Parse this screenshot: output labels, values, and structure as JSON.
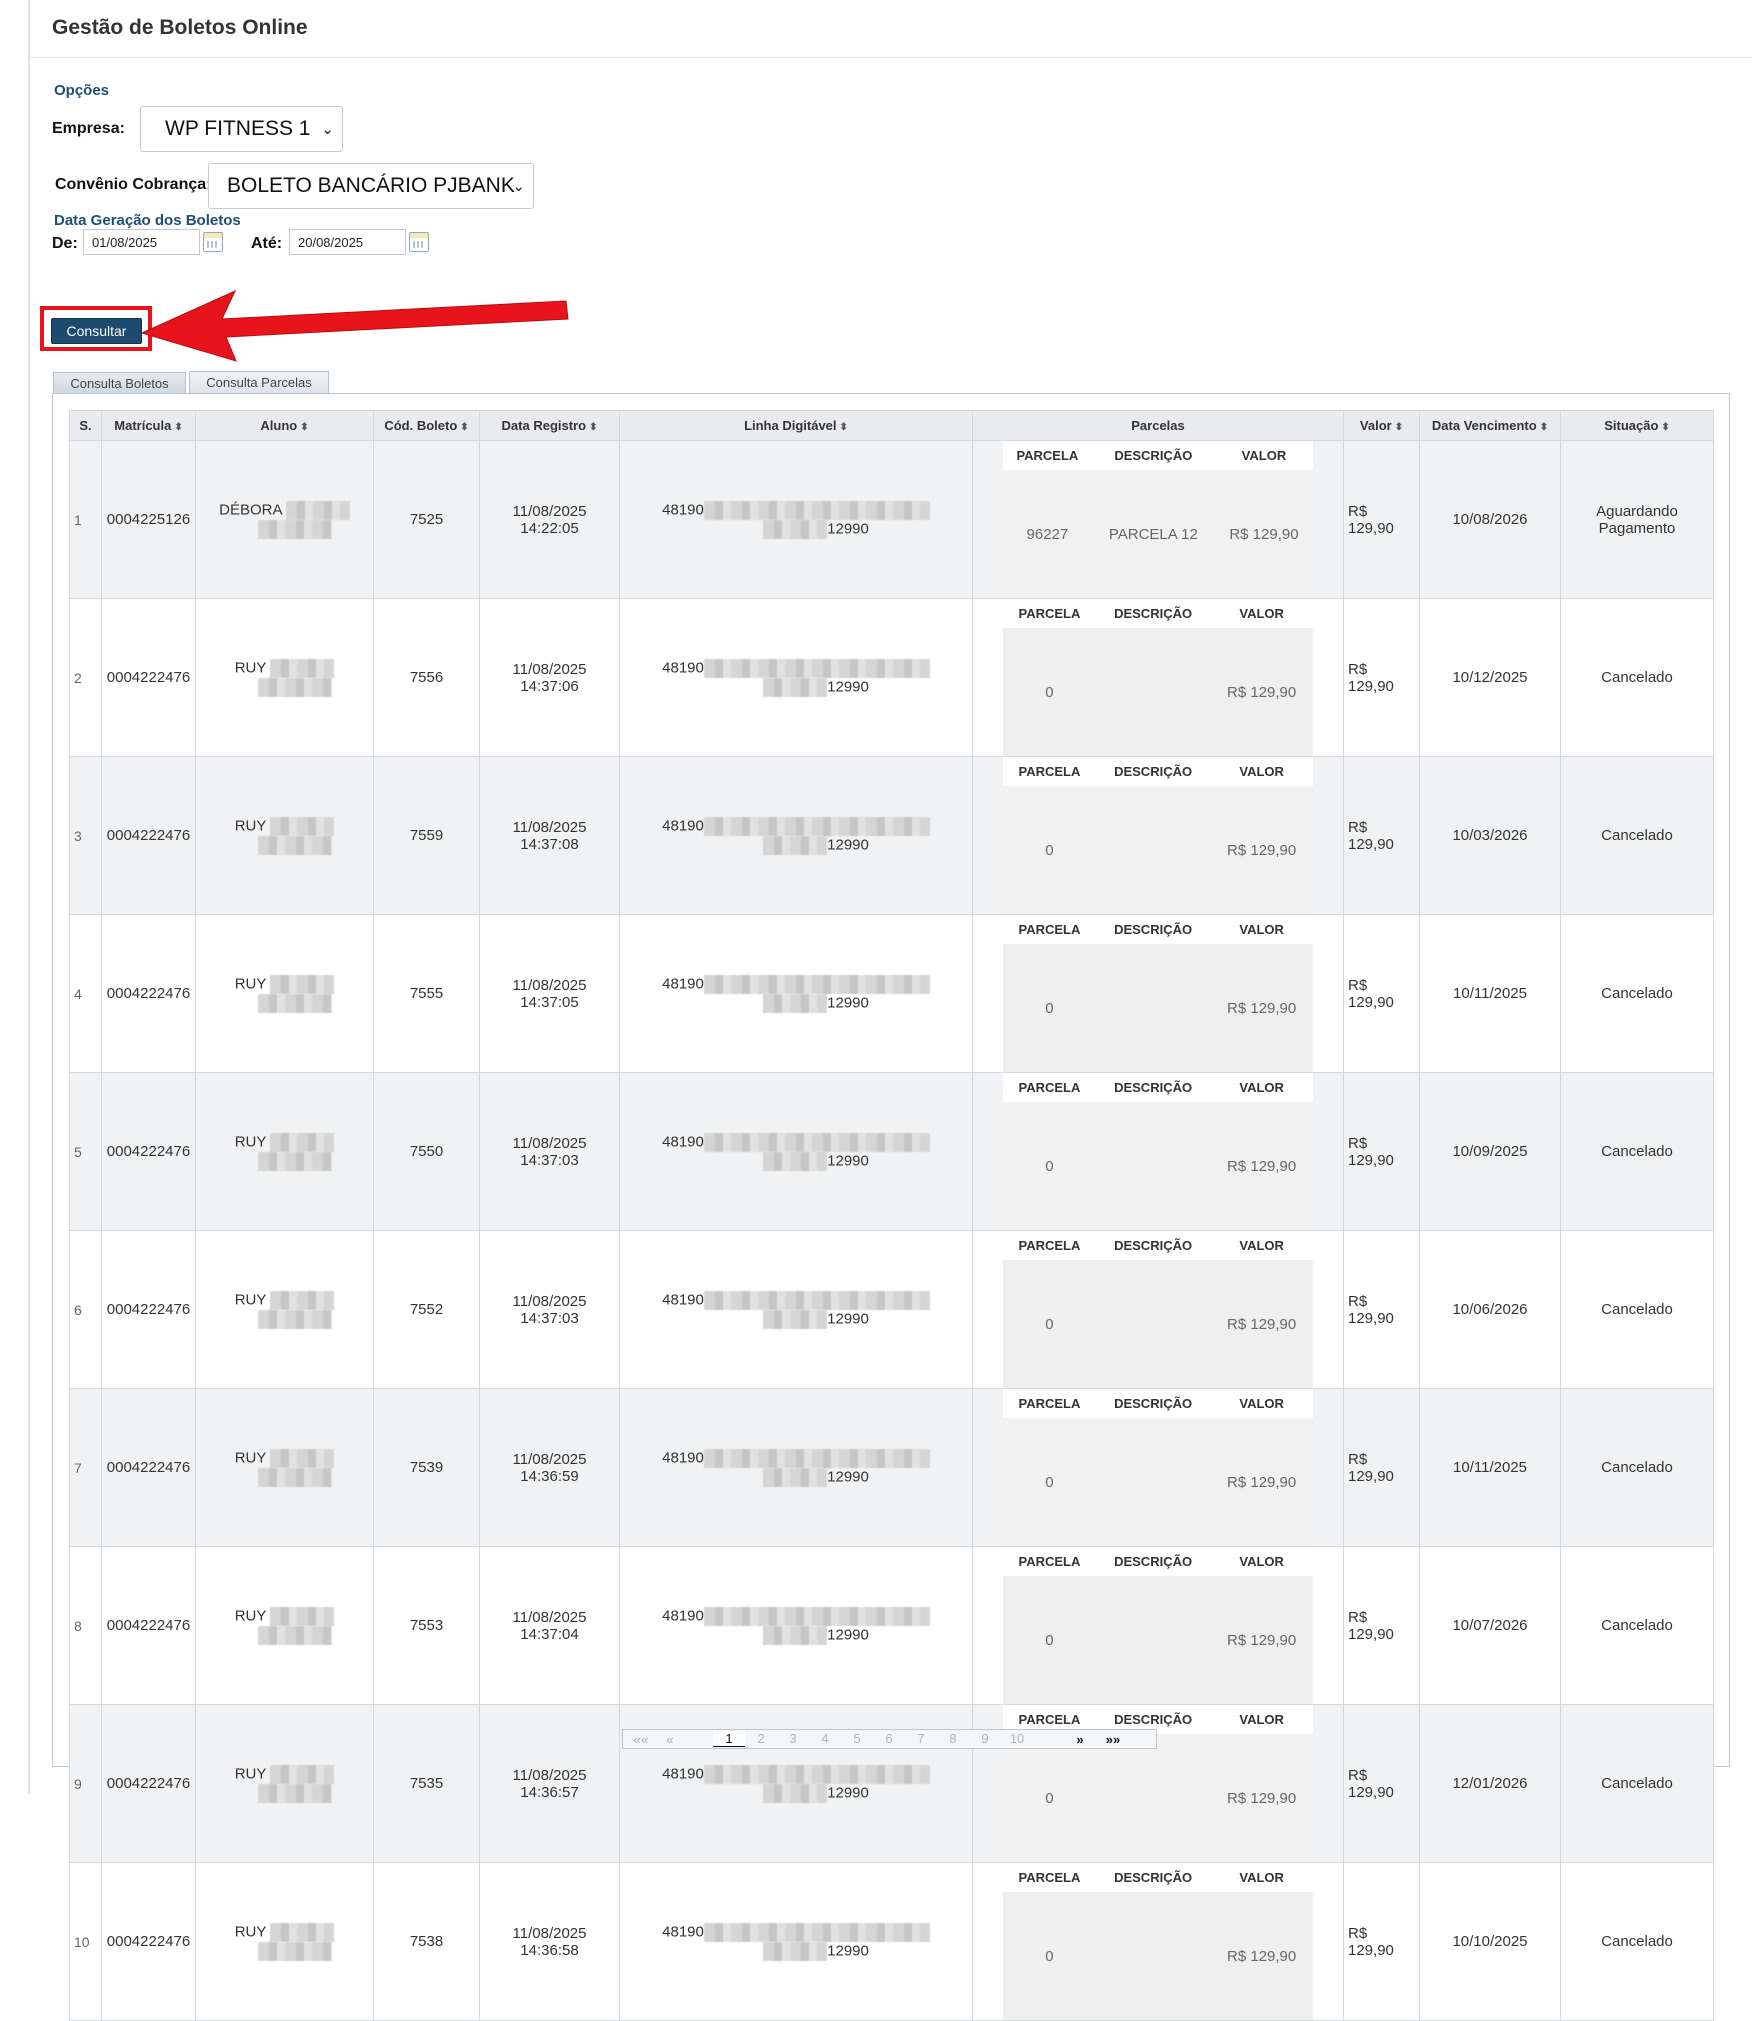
{
  "page": {
    "title": "Gestão de Boletos Online"
  },
  "filters": {
    "options_heading": "Opções",
    "empresa_label": "Empresa:",
    "empresa_value": "WP FITNESS 1",
    "convenio_label": "Convênio Cobrança:",
    "convenio_value": "BOLETO BANCÁRIO PJBANK",
    "date_heading": "Data Geração dos Boletos",
    "de_label": "De:",
    "de_value": "01/08/2025",
    "ate_label": "Até:",
    "ate_value": "20/08/2025",
    "consultar_label": "Consultar"
  },
  "tabs": [
    {
      "label": "Consulta Boletos"
    },
    {
      "label": "Consulta Parcelas"
    }
  ],
  "table": {
    "headers": [
      "S.",
      "Matrícula",
      "Aluno",
      "Cód. Boleto",
      "Data Registro",
      "Linha Digitável",
      "Parcelas",
      "Valor",
      "Data Vencimento",
      "Situação"
    ],
    "inner_headers": [
      "PARCELA",
      "DESCRIÇÃO",
      "VALOR"
    ],
    "rows": [
      {
        "s": "1",
        "matricula": "0004225126",
        "aluno": "DÉBORA",
        "cod": "7525",
        "data": "11/08/2025",
        "hora": "14:22:05",
        "linha_ini": "48190",
        "linha_fim": "12990",
        "parcela": "96227",
        "descricao": "PARCELA 12",
        "pvalor": "R$ 129,90",
        "valor1": "R$",
        "valor2": "129,90",
        "venc": "10/08/2026",
        "sit": "Aguardando Pagamento"
      },
      {
        "s": "2",
        "matricula": "0004222476",
        "aluno": "RUY",
        "cod": "7556",
        "data": "11/08/2025",
        "hora": "14:37:06",
        "linha_ini": "48190",
        "linha_fim": "12990",
        "parcela": "0",
        "descricao": "",
        "pvalor": "R$ 129,90",
        "valor1": "R$",
        "valor2": "129,90",
        "venc": "10/12/2025",
        "sit": "Cancelado"
      },
      {
        "s": "3",
        "matricula": "0004222476",
        "aluno": "RUY",
        "cod": "7559",
        "data": "11/08/2025",
        "hora": "14:37:08",
        "linha_ini": "48190",
        "linha_fim": "12990",
        "parcela": "0",
        "descricao": "",
        "pvalor": "R$ 129,90",
        "valor1": "R$",
        "valor2": "129,90",
        "venc": "10/03/2026",
        "sit": "Cancelado"
      },
      {
        "s": "4",
        "matricula": "0004222476",
        "aluno": "RUY",
        "cod": "7555",
        "data": "11/08/2025",
        "hora": "14:37:05",
        "linha_ini": "48190",
        "linha_fim": "12990",
        "parcela": "0",
        "descricao": "",
        "pvalor": "R$ 129,90",
        "valor1": "R$",
        "valor2": "129,90",
        "venc": "10/11/2025",
        "sit": "Cancelado"
      },
      {
        "s": "5",
        "matricula": "0004222476",
        "aluno": "RUY",
        "cod": "7550",
        "data": "11/08/2025",
        "hora": "14:37:03",
        "linha_ini": "48190",
        "linha_fim": "12990",
        "parcela": "0",
        "descricao": "",
        "pvalor": "R$ 129,90",
        "valor1": "R$",
        "valor2": "129,90",
        "venc": "10/09/2025",
        "sit": "Cancelado"
      },
      {
        "s": "6",
        "matricula": "0004222476",
        "aluno": "RUY",
        "cod": "7552",
        "data": "11/08/2025",
        "hora": "14:37:03",
        "linha_ini": "48190",
        "linha_fim": "12990",
        "parcela": "0",
        "descricao": "",
        "pvalor": "R$ 129,90",
        "valor1": "R$",
        "valor2": "129,90",
        "venc": "10/06/2026",
        "sit": "Cancelado"
      },
      {
        "s": "7",
        "matricula": "0004222476",
        "aluno": "RUY",
        "cod": "7539",
        "data": "11/08/2025",
        "hora": "14:36:59",
        "linha_ini": "48190",
        "linha_fim": "12990",
        "parcela": "0",
        "descricao": "",
        "pvalor": "R$ 129,90",
        "valor1": "R$",
        "valor2": "129,90",
        "venc": "10/11/2025",
        "sit": "Cancelado"
      },
      {
        "s": "8",
        "matricula": "0004222476",
        "aluno": "RUY",
        "cod": "7553",
        "data": "11/08/2025",
        "hora": "14:37:04",
        "linha_ini": "48190",
        "linha_fim": "12990",
        "parcela": "0",
        "descricao": "",
        "pvalor": "R$ 129,90",
        "valor1": "R$",
        "valor2": "129,90",
        "venc": "10/07/2026",
        "sit": "Cancelado"
      },
      {
        "s": "9",
        "matricula": "0004222476",
        "aluno": "RUY",
        "cod": "7535",
        "data": "11/08/2025",
        "hora": "14:36:57",
        "linha_ini": "48190",
        "linha_fim": "12990",
        "parcela": "0",
        "descricao": "",
        "pvalor": "R$ 129,90",
        "valor1": "R$",
        "valor2": "129,90",
        "venc": "12/01/2026",
        "sit": "Cancelado"
      },
      {
        "s": "10",
        "matricula": "0004222476",
        "aluno": "RUY",
        "cod": "7538",
        "data": "11/08/2025",
        "hora": "14:36:58",
        "linha_ini": "48190",
        "linha_fim": "12990",
        "parcela": "0",
        "descricao": "",
        "pvalor": "R$ 129,90",
        "valor1": "R$",
        "valor2": "129,90",
        "venc": "10/10/2025",
        "sit": "Cancelado"
      }
    ]
  },
  "pager": {
    "first": "««",
    "prev": "«",
    "pages": [
      "1",
      "2",
      "3",
      "4",
      "5",
      "6",
      "7",
      "8",
      "9",
      "10"
    ],
    "current": "1",
    "next": "»",
    "last": "»»"
  },
  "colors": {
    "accent": "#1c4b6e",
    "highlight": "#e8141c"
  }
}
